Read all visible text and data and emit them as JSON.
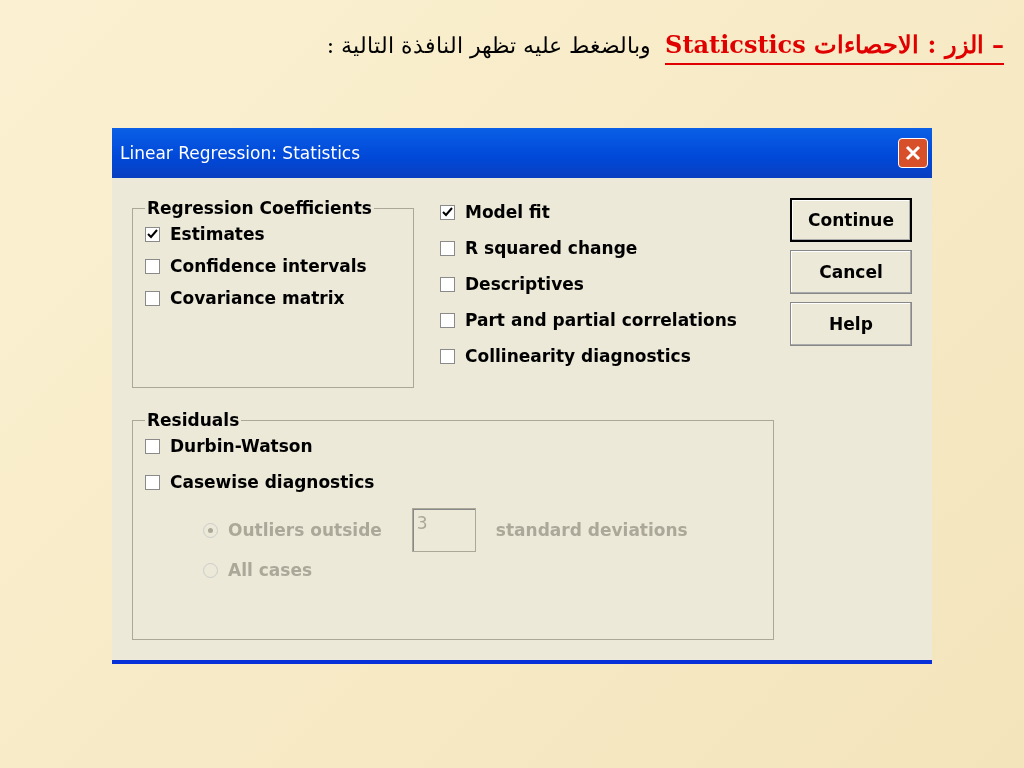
{
  "heading": {
    "highlight": "– الزر : الاحصاءات Staticstics",
    "rest": "وبالضغط عليه تظهر النافذة التالية :"
  },
  "dialog": {
    "title": "Linear Regression: Statistics",
    "regression_coefficients": {
      "title": "Regression Coefficients",
      "options": [
        {
          "label": "Estimates",
          "checked": true
        },
        {
          "label": "Confidence intervals",
          "checked": false
        },
        {
          "label": "Covariance matrix",
          "checked": false
        }
      ]
    },
    "options": [
      {
        "label": "Model fit",
        "checked": true
      },
      {
        "label": "R squared change",
        "checked": false
      },
      {
        "label": "Descriptives",
        "checked": false
      },
      {
        "label": "Part and partial correlations",
        "checked": false
      },
      {
        "label": "Collinearity diagnostics",
        "checked": false
      }
    ],
    "buttons": [
      {
        "label": "Continue",
        "default": true
      },
      {
        "label": "Cancel",
        "default": false
      },
      {
        "label": "Help",
        "default": false
      }
    ],
    "residuals": {
      "title": "Residuals",
      "options": [
        {
          "label": "Durbin-Watson",
          "checked": false
        },
        {
          "label": "Casewise diagnostics",
          "checked": false
        }
      ],
      "radios": [
        {
          "label": "Outliers outside",
          "selected": true,
          "disabled": true,
          "value": "3",
          "suffix": "standard deviations"
        },
        {
          "label": "All cases",
          "selected": false,
          "disabled": true
        }
      ]
    }
  }
}
